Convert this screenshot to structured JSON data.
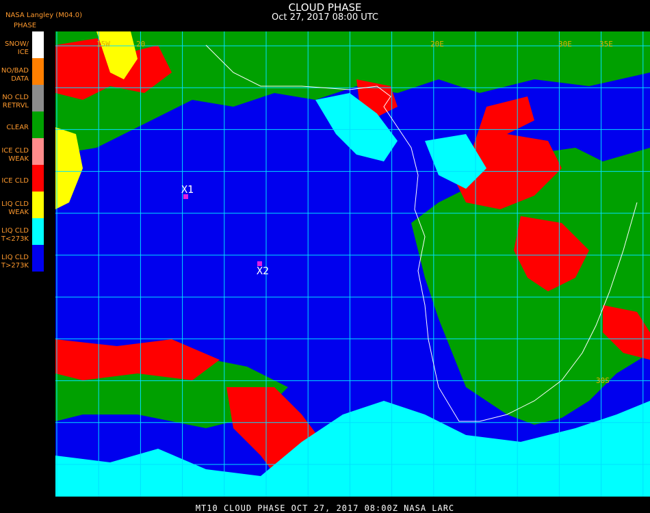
{
  "header": {
    "title": "CLOUD PHASE",
    "subtitle": "Oct 27, 2017 08:00 UTC",
    "provider": "NASA Langley (M04.0)",
    "legend_title": "PHASE"
  },
  "legend": [
    {
      "line1": "SNOW/",
      "line2": "ICE",
      "color": "#ffffff"
    },
    {
      "line1": "NO/BAD",
      "line2": "DATA",
      "color": "#ff7f00"
    },
    {
      "line1": "NO CLD",
      "line2": "RETRVL",
      "color": "#8c8c8c"
    },
    {
      "line1": "CLEAR",
      "line2": "",
      "color": "#00a000"
    },
    {
      "line1": "ICE CLD",
      "line2": "WEAK",
      "color": "#ff8c8c"
    },
    {
      "line1": "ICE CLD",
      "line2": "",
      "color": "#ff0000"
    },
    {
      "line1": "LIQ CLD",
      "line2": "WEAK",
      "color": "#ffff00"
    },
    {
      "line1": "LIQ CLD",
      "line2": "T<273K",
      "color": "#00ffff"
    },
    {
      "line1": "LIQ CLD",
      "line2": "T>273K",
      "color": "#0000ee"
    }
  ],
  "map": {
    "markers": [
      {
        "label": "X1"
      },
      {
        "label": "X2"
      }
    ],
    "grid_labels": [
      "15W",
      "20",
      "20E",
      "30E",
      "35E",
      "30S"
    ],
    "grid_color": "#00e0ff",
    "coast_color": "#ffffff"
  },
  "footer": {
    "text": "MT10  CLOUD PHASE   OCT 27, 2017 08:00Z   NASA LARC"
  }
}
